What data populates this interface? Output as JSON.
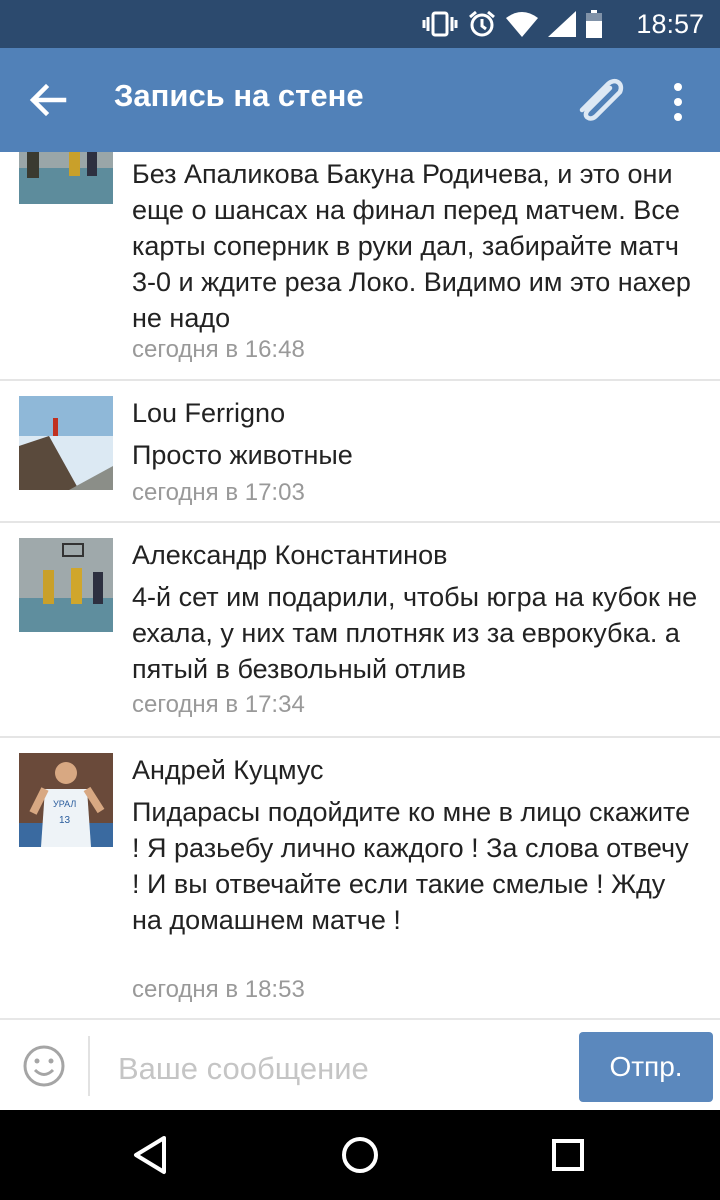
{
  "status_bar": {
    "time": "18:57"
  },
  "app_bar": {
    "title": "Запись на стене"
  },
  "comments": [
    {
      "name": "",
      "text": "Без Апаликова Бакуна Родичева, и это они еще о шансах на финал перед матчем. Все карты соперник в руки дал, забирайте матч 3-0 и ждите реза Локо. Видимо им это нахер не надо",
      "time": "сегодня в 16:48"
    },
    {
      "name": "Lou Ferrigno",
      "text": "Просто животные",
      "time": "сегодня в 17:03"
    },
    {
      "name": "Александр Константинов",
      "text": "4-й сет им подарили, чтобы югра на кубок не ехала, у них там плотняк из за еврокубка. а пятый в безвольный отлив",
      "time": "сегодня в 17:34"
    },
    {
      "name": "Андрей Куцмус",
      "text": "Пидарасы подойдите ко мне в лицо скажите ! Я разьебу лично каждого ! За слова отвечу ! И вы отвечайте если такие смелые ! Жду на домашнем матче !",
      "time": "сегодня в 18:53"
    }
  ],
  "composer": {
    "placeholder": "Ваше сообщение",
    "send_label": "Отпр."
  },
  "avatar_texts": {
    "jersey_team": "УРАЛ",
    "jersey_number": "13"
  }
}
